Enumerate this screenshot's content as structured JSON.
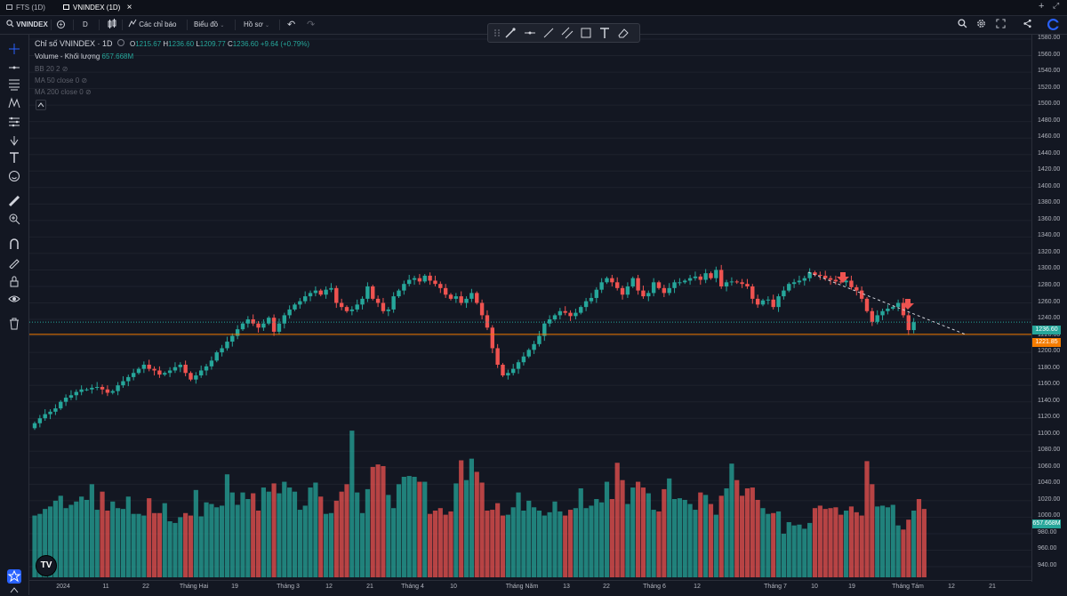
{
  "tabs": [
    {
      "label": "FTS (1D)",
      "active": false
    },
    {
      "label": "VNINDEX (1D)",
      "active": true
    }
  ],
  "tab_close": "×",
  "window_controls": [
    "+",
    "⤢"
  ],
  "toolbar": {
    "symbol": "VNINDEX",
    "add": "+",
    "interval": "D",
    "indicators": "Các chỉ báo",
    "chart_style": "Biểu đồ",
    "profile": "Hồ sơ"
  },
  "legend": {
    "title": "Chỉ số VNINDEX · 1D",
    "o_label": "O",
    "o": "1215.67",
    "h_label": "H",
    "h": "1236.60",
    "l_label": "L",
    "l": "1209.77",
    "c_label": "C",
    "c": "1236.60",
    "change": "+9.64 (+0.79%)",
    "volume_label": "Volume - Khối lượng",
    "volume_value": "657.668M",
    "bb": "BB 20 2",
    "ma50": "MA 50 close 0",
    "ma200": "MA 200 close 0"
  },
  "price_labels": {
    "last": "1236.60",
    "support": "1221.85",
    "volume": "657.668M"
  },
  "price_axis": [
    "1580.00",
    "1560.00",
    "1540.00",
    "1520.00",
    "1500.00",
    "1480.00",
    "1460.00",
    "1440.00",
    "1420.00",
    "1400.00",
    "1380.00",
    "1360.00",
    "1340.00",
    "1320.00",
    "1300.00",
    "1280.00",
    "1260.00",
    "1240.00",
    "1220.00",
    "1200.00",
    "1180.00",
    "1160.00",
    "1140.00",
    "1120.00",
    "1100.00",
    "1080.00",
    "1060.00",
    "1040.00",
    "1020.00",
    "1000.00",
    "980.00",
    "960.00",
    "940.00"
  ],
  "time_axis": [
    "2024",
    "11",
    "22",
    "Tháng Hai",
    "19",
    "Tháng 3",
    "12",
    "21",
    "Tháng 4",
    "10",
    "Tháng Năm",
    "13",
    "22",
    "Tháng 6",
    "12",
    "Tháng 7",
    "10",
    "19",
    "Tháng Tám",
    "12",
    "21"
  ],
  "colors": {
    "up": "#26a69a",
    "down": "#ef5350",
    "bg": "#131722",
    "grid": "#1e222d",
    "support": "#f57c00",
    "vol_up": "#26a69a",
    "vol_down": "#ef5350"
  },
  "tv_logo": "TV",
  "chart_data": {
    "type": "candlestick",
    "symbol": "VNINDEX",
    "interval": "1D",
    "ylim": [
      940,
      1580
    ],
    "support_level": 1221.85,
    "last_close": 1236.6,
    "closes": [
      1114,
      1120,
      1125,
      1128,
      1132,
      1140,
      1145,
      1148,
      1152,
      1155,
      1155,
      1157,
      1158,
      1155,
      1151,
      1153,
      1160,
      1165,
      1170,
      1175,
      1180,
      1185,
      1180,
      1178,
      1173,
      1175,
      1178,
      1182,
      1185,
      1175,
      1167,
      1172,
      1178,
      1183,
      1190,
      1200,
      1205,
      1213,
      1220,
      1228,
      1235,
      1240,
      1235,
      1230,
      1235,
      1242,
      1225,
      1235,
      1245,
      1252,
      1258,
      1262,
      1268,
      1272,
      1275,
      1270,
      1276,
      1278,
      1260,
      1255,
      1250,
      1252,
      1258,
      1265,
      1280,
      1265,
      1260,
      1250,
      1252,
      1268,
      1275,
      1283,
      1288,
      1290,
      1286,
      1293,
      1287,
      1283,
      1278,
      1270,
      1265,
      1268,
      1260,
      1265,
      1272,
      1260,
      1245,
      1230,
      1205,
      1185,
      1172,
      1175,
      1180,
      1188,
      1195,
      1203,
      1210,
      1220,
      1235,
      1240,
      1245,
      1250,
      1248,
      1244,
      1248,
      1255,
      1262,
      1266,
      1276,
      1285,
      1290,
      1285,
      1278,
      1270,
      1280,
      1290,
      1275,
      1268,
      1272,
      1285,
      1278,
      1272,
      1278,
      1285,
      1285,
      1287,
      1290,
      1292,
      1288,
      1296,
      1290,
      1300,
      1280,
      1285,
      1286,
      1285,
      1283,
      1280,
      1265,
      1258,
      1263,
      1264,
      1255,
      1268,
      1275,
      1283,
      1285,
      1287,
      1290,
      1297,
      1294,
      1293,
      1290,
      1288,
      1286,
      1285,
      1287,
      1279,
      1275,
      1265,
      1250,
      1237,
      1245,
      1250,
      1253,
      1255,
      1260,
      1245,
      1227,
      1236.6
    ],
    "volumes": [
      1002,
      1004,
      1010,
      1013,
      1020,
      1026,
      1011,
      1015,
      1019,
      1025,
      1021,
      1040,
      1009,
      1031,
      1008,
      1019,
      1011,
      1010,
      1025,
      1004,
      1004,
      1002,
      1023,
      1005,
      1005,
      1017,
      995,
      993,
      1000,
      1005,
      1002,
      1033,
      1001,
      1018,
      1016,
      1012,
      1014,
      1052,
      1030,
      1015,
      1030,
      1022,
      1029,
      1008,
      1036,
      1031,
      1041,
      1029,
      1043,
      1036,
      1031,
      1009,
      1014,
      1036,
      1042,
      1025,
      1004,
      1005,
      1020,
      1031,
      1040,
      1105,
      1030,
      1005,
      1034,
      1061,
      1064,
      1062,
      1027,
      1011,
      1040,
      1049,
      1050,
      1049,
      1043,
      1043,
      1004,
      1008,
      1011,
      1003,
      1007,
      1041,
      1069,
      1045,
      1071,
      1055,
      1042,
      1008,
      1009,
      1017,
      1002,
      1003,
      1012,
      1030,
      1008,
      1020,
      1012,
      1008,
      1002,
      1006,
      1019,
      1007,
      1002,
      1009,
      1011,
      1035,
      1011,
      1014,
      1022,
      1018,
      1043,
      1022,
      1066,
      1045,
      1016,
      1036,
      1043,
      1036,
      1029,
      1009,
      1007,
      1034,
      1047,
      1022,
      1023,
      1021,
      1016,
      1009,
      1030,
      1027,
      1016,
      1003,
      1026,
      1035,
      1065,
      1045,
      1026,
      1035,
      1036,
      1021,
      1011,
      1004,
      1005,
      1007,
      980,
      994,
      990,
      991,
      986,
      993,
      1011,
      1014,
      1010,
      1011,
      1012,
      1003,
      1008,
      1013,
      1006,
      1002,
      1068,
      1040,
      1013,
      1014,
      1012,
      1015,
      990,
      985,
      997,
      1008,
      1022,
      1010
    ]
  }
}
